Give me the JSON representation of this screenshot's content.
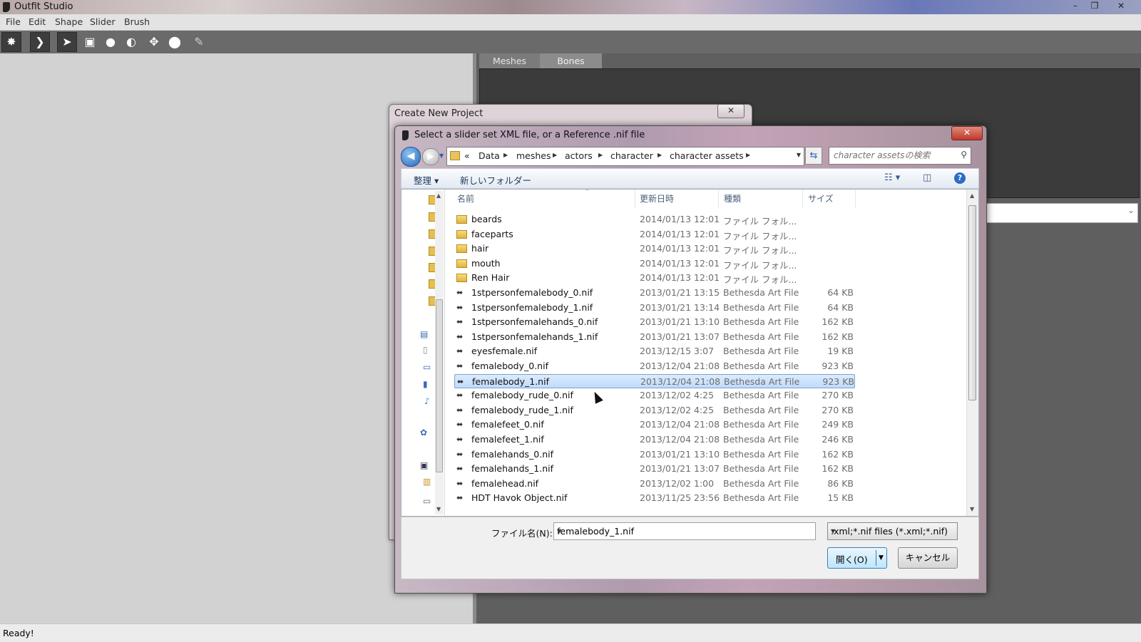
{
  "app": {
    "title": "Outfit Studio",
    "window_controls": [
      "–",
      "❐",
      "✕"
    ],
    "menu": [
      "File",
      "Edit",
      "Shape",
      "Slider",
      "Brush"
    ],
    "toolbar_icons": [
      "new-project-icon",
      "load-project-icon",
      "select-tool-icon",
      "mask-tool-icon",
      "inflate-brush-icon",
      "deflate-brush-icon",
      "move-brush-icon",
      "smooth-brush-icon",
      "paint-brush-icon"
    ],
    "tabs": [
      "Meshes",
      "Bones"
    ],
    "status": "Ready!"
  },
  "create_project": {
    "title": "Create New Project",
    "close": "✕"
  },
  "file_dialog": {
    "title": "Select a slider set XML file, or a Reference .nif file",
    "close": "✕",
    "breadcrumb_prefix": "«",
    "breadcrumb": [
      "Data",
      "meshes",
      "actors",
      "character",
      "character assets"
    ],
    "search_placeholder": "character assetsの検索",
    "organize": "整理",
    "new_folder": "新しいフォルダー",
    "columns": {
      "name": "名前",
      "date": "更新日時",
      "type": "種類",
      "size": "サイズ"
    },
    "files": [
      {
        "name": "beards",
        "date": "2014/01/13 12:01",
        "type": "ファイル フォル...",
        "size": "",
        "kind": "folder"
      },
      {
        "name": "faceparts",
        "date": "2014/01/13 12:01",
        "type": "ファイル フォル...",
        "size": "",
        "kind": "folder"
      },
      {
        "name": "hair",
        "date": "2014/01/13 12:01",
        "type": "ファイル フォル...",
        "size": "",
        "kind": "folder"
      },
      {
        "name": "mouth",
        "date": "2014/01/13 12:01",
        "type": "ファイル フォル...",
        "size": "",
        "kind": "folder"
      },
      {
        "name": "Ren Hair",
        "date": "2014/01/13 12:01",
        "type": "ファイル フォル...",
        "size": "",
        "kind": "folder"
      },
      {
        "name": "1stpersonfemalebody_0.nif",
        "date": "2013/01/21 13:15",
        "type": "Bethesda Art File",
        "size": "64 KB",
        "kind": "nif"
      },
      {
        "name": "1stpersonfemalebody_1.nif",
        "date": "2013/01/21 13:14",
        "type": "Bethesda Art File",
        "size": "64 KB",
        "kind": "nif"
      },
      {
        "name": "1stpersonfemalehands_0.nif",
        "date": "2013/01/21 13:10",
        "type": "Bethesda Art File",
        "size": "162 KB",
        "kind": "nif"
      },
      {
        "name": "1stpersonfemalehands_1.nif",
        "date": "2013/01/21 13:07",
        "type": "Bethesda Art File",
        "size": "162 KB",
        "kind": "nif"
      },
      {
        "name": "eyesfemale.nif",
        "date": "2013/12/15 3:07",
        "type": "Bethesda Art File",
        "size": "19 KB",
        "kind": "nif"
      },
      {
        "name": "femalebody_0.nif",
        "date": "2013/12/04 21:08",
        "type": "Bethesda Art File",
        "size": "923 KB",
        "kind": "nif"
      },
      {
        "name": "femalebody_1.nif",
        "date": "2013/12/04 21:08",
        "type": "Bethesda Art File",
        "size": "923 KB",
        "kind": "nif",
        "selected": true
      },
      {
        "name": "femalebody_rude_0.nif",
        "date": "2013/12/02 4:25",
        "type": "Bethesda Art File",
        "size": "270 KB",
        "kind": "nif"
      },
      {
        "name": "femalebody_rude_1.nif",
        "date": "2013/12/02 4:25",
        "type": "Bethesda Art File",
        "size": "270 KB",
        "kind": "nif"
      },
      {
        "name": "femalefeet_0.nif",
        "date": "2013/12/04 21:08",
        "type": "Bethesda Art File",
        "size": "249 KB",
        "kind": "nif"
      },
      {
        "name": "femalefeet_1.nif",
        "date": "2013/12/04 21:08",
        "type": "Bethesda Art File",
        "size": "246 KB",
        "kind": "nif"
      },
      {
        "name": "femalehands_0.nif",
        "date": "2013/01/21 13:10",
        "type": "Bethesda Art File",
        "size": "162 KB",
        "kind": "nif"
      },
      {
        "name": "femalehands_1.nif",
        "date": "2013/01/21 13:07",
        "type": "Bethesda Art File",
        "size": "162 KB",
        "kind": "nif"
      },
      {
        "name": "femalehead.nif",
        "date": "2013/12/02 1:00",
        "type": "Bethesda Art File",
        "size": "86 KB",
        "kind": "nif"
      },
      {
        "name": "HDT Havok Object.nif",
        "date": "2013/11/25 23:56",
        "type": "Bethesda Art File",
        "size": "15 KB",
        "kind": "nif"
      }
    ],
    "filename_label": "ファイル名(N):",
    "filename_value": "femalebody_1.nif",
    "filetype": ".xml;*.nif files (*.xml;*.nif)",
    "open_button": "開く(O)",
    "cancel_button": "キャンセル"
  }
}
